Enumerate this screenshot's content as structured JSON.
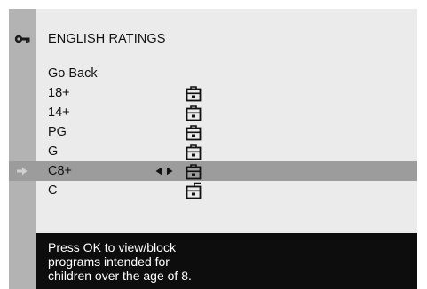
{
  "header": {
    "icon": "key-icon",
    "title": "ENGLISH RATINGS"
  },
  "menu": {
    "items": [
      {
        "label": "Go Back",
        "locked": null,
        "selected": false
      },
      {
        "label": "18+",
        "locked": true,
        "selected": false
      },
      {
        "label": "14+",
        "locked": true,
        "selected": false
      },
      {
        "label": "PG",
        "locked": true,
        "selected": false
      },
      {
        "label": "G",
        "locked": true,
        "selected": false
      },
      {
        "label": "C8+",
        "locked": true,
        "selected": true
      },
      {
        "label": "C",
        "locked": false,
        "selected": false
      }
    ]
  },
  "help": {
    "text": "Press OK to view/block\nprograms intended for\nchildren over the age of 8."
  },
  "colors": {
    "background": "#ebebeb",
    "left_strip": "#b3b3b3",
    "selected_row": "#9c9c9c",
    "help_bar": "#0d0d0d",
    "help_text": "#ffffff"
  }
}
